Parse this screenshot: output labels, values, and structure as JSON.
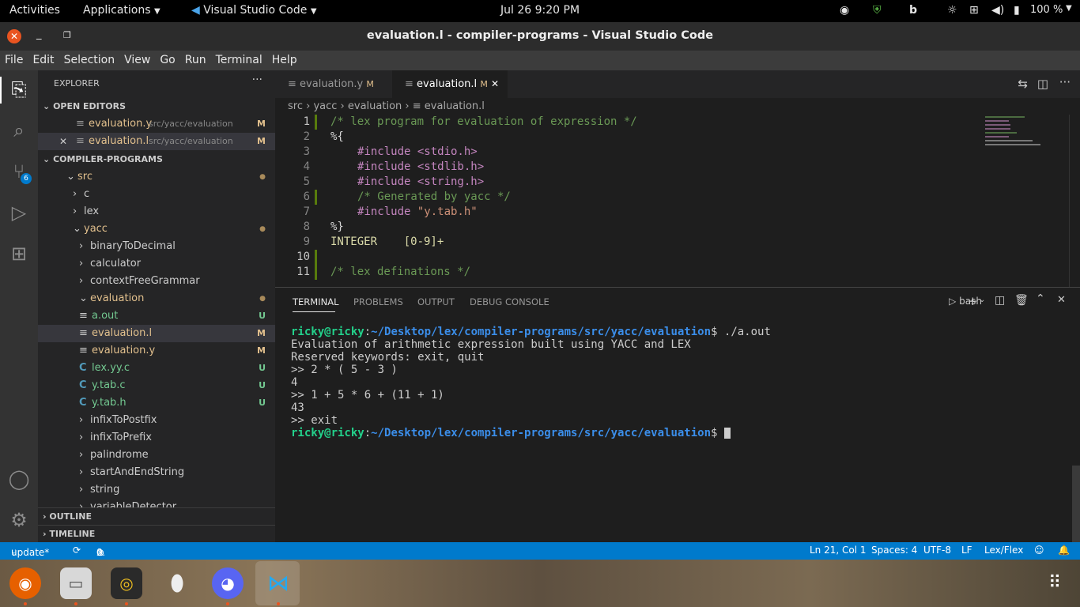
{
  "topbar": {
    "activities": "Activities",
    "applications": "Applications",
    "vscode": "Visual Studio Code",
    "clock": "Jul 26  9:20 PM",
    "battery": "100 %"
  },
  "window": {
    "title": "evaluation.l - compiler-programs - Visual Studio Code"
  },
  "menu": [
    "File",
    "Edit",
    "Selection",
    "View",
    "Go",
    "Run",
    "Terminal",
    "Help"
  ],
  "activity": {
    "scm_badge": "6"
  },
  "sidebar": {
    "title": "EXPLORER",
    "open_editors": "OPEN EDITORS",
    "open_files": [
      {
        "name": "evaluation.y",
        "path": "src/yacc/evaluation",
        "badge": "M"
      },
      {
        "name": "evaluation.l",
        "path": "src/yacc/evaluation",
        "badge": "M"
      }
    ],
    "project": "COMPILER-PROGRAMS",
    "tree": [
      {
        "label": "src",
        "indent": 1,
        "chev": "⌄",
        "kind": "folder",
        "badge": "●"
      },
      {
        "label": "c",
        "indent": 2,
        "chev": "›",
        "kind": "folder",
        "badge": ""
      },
      {
        "label": "lex",
        "indent": 2,
        "chev": "›",
        "kind": "folder",
        "badge": ""
      },
      {
        "label": "yacc",
        "indent": 2,
        "chev": "⌄",
        "kind": "folder",
        "badge": "●"
      },
      {
        "label": "binaryToDecimal",
        "indent": 3,
        "chev": "›",
        "kind": "folder",
        "badge": ""
      },
      {
        "label": "calculator",
        "indent": 3,
        "chev": "›",
        "kind": "folder",
        "badge": ""
      },
      {
        "label": "contextFreeGrammar",
        "indent": 3,
        "chev": "›",
        "kind": "folder",
        "badge": ""
      },
      {
        "label": "evaluation",
        "indent": 3,
        "chev": "⌄",
        "kind": "folder",
        "badge": "●"
      },
      {
        "label": "a.out",
        "indent": 4,
        "chev": "",
        "kind": "file",
        "icon": "≡",
        "badge": "U"
      },
      {
        "label": "evaluation.l",
        "indent": 4,
        "chev": "",
        "kind": "file",
        "icon": "≡",
        "badge": "M"
      },
      {
        "label": "evaluation.y",
        "indent": 4,
        "chev": "",
        "kind": "file",
        "icon": "≡",
        "badge": "M"
      },
      {
        "label": "lex.yy.c",
        "indent": 4,
        "chev": "",
        "kind": "file",
        "icon": "C",
        "badge": "U"
      },
      {
        "label": "y.tab.c",
        "indent": 4,
        "chev": "",
        "kind": "file",
        "icon": "C",
        "badge": "U"
      },
      {
        "label": "y.tab.h",
        "indent": 4,
        "chev": "",
        "kind": "file",
        "icon": "C",
        "badge": "U"
      },
      {
        "label": "infixToPostfix",
        "indent": 3,
        "chev": "›",
        "kind": "folder",
        "badge": ""
      },
      {
        "label": "infixToPrefix",
        "indent": 3,
        "chev": "›",
        "kind": "folder",
        "badge": ""
      },
      {
        "label": "palindrome",
        "indent": 3,
        "chev": "›",
        "kind": "folder",
        "badge": ""
      },
      {
        "label": "startAndEndString",
        "indent": 3,
        "chev": "›",
        "kind": "folder",
        "badge": ""
      },
      {
        "label": "string",
        "indent": 3,
        "chev": "›",
        "kind": "folder",
        "badge": ""
      },
      {
        "label": "variableDetector",
        "indent": 3,
        "chev": "›",
        "kind": "folder",
        "badge": ""
      }
    ],
    "outline": "OUTLINE",
    "timeline": "TIMELINE"
  },
  "tabs": [
    {
      "name": "evaluation.y",
      "badge": "M"
    },
    {
      "name": "evaluation.l",
      "badge": "M"
    }
  ],
  "breadcrumb": [
    "src",
    "yacc",
    "evaluation",
    "evaluation.l"
  ],
  "code": [
    {
      "n": "1",
      "text": "/* lex program for evaluation of expression */",
      "color": "#6a9955",
      "indent": 0
    },
    {
      "n": "2",
      "text": "%{",
      "color": "#d4d4d4",
      "indent": 0
    },
    {
      "n": "3",
      "text": "#include <stdio.h>",
      "color": "#c586c0",
      "indent": 1
    },
    {
      "n": "4",
      "text": "#include <stdlib.h>",
      "color": "#c586c0",
      "indent": 1
    },
    {
      "n": "5",
      "text": "#include <string.h>",
      "color": "#c586c0",
      "indent": 1
    },
    {
      "n": "6",
      "text": "/* Generated by yacc */",
      "color": "#6a9955",
      "indent": 1
    },
    {
      "n": "7",
      "text": "#include \"y.tab.h\"",
      "color": "#c586c0",
      "indent": 1
    },
    {
      "n": "8",
      "text": "%}",
      "color": "#d4d4d4",
      "indent": 0
    },
    {
      "n": "9",
      "text": "INTEGER    [0-9]+",
      "color": "#dcdcaa",
      "indent": 0
    },
    {
      "n": "10",
      "text": "",
      "color": "#d4d4d4",
      "indent": 0
    },
    {
      "n": "11",
      "text": "/* lex definations */",
      "color": "#6a9955",
      "indent": 0
    }
  ],
  "panel": {
    "tabs": [
      "TERMINAL",
      "PROBLEMS",
      "OUTPUT",
      "DEBUG CONSOLE"
    ],
    "shell": "bash",
    "prompt_user": "ricky@ricky",
    "prompt_path": "~/Desktop/lex/compiler-programs/src/yacc/evaluation",
    "command": "./a.out",
    "output": [
      "Evaluation of arithmetic expression built using YACC and LEX",
      "Reserved keywords: exit, quit",
      ">> 2 * ( 5 - 3 )",
      "4",
      ">> 1 + 5 * 6 + (11 + 1)",
      "43",
      ">> exit"
    ]
  },
  "status": {
    "branch": "update*",
    "errors": "0",
    "warnings": "0",
    "position": "Ln 21, Col 1",
    "spaces": "Spaces: 4",
    "encoding": "UTF-8",
    "eol": "LF",
    "language": "Lex/Flex"
  },
  "colors": {
    "accent": "#007acc",
    "folder_text": "#cccccc",
    "modified": "#e2c08d",
    "untracked": "#73c991",
    "c_icon": "#519aba",
    "comment": "#6a9955",
    "keyword": "#c586c0",
    "prompt_user": "#23d18b",
    "prompt_path": "#3b8eea"
  }
}
